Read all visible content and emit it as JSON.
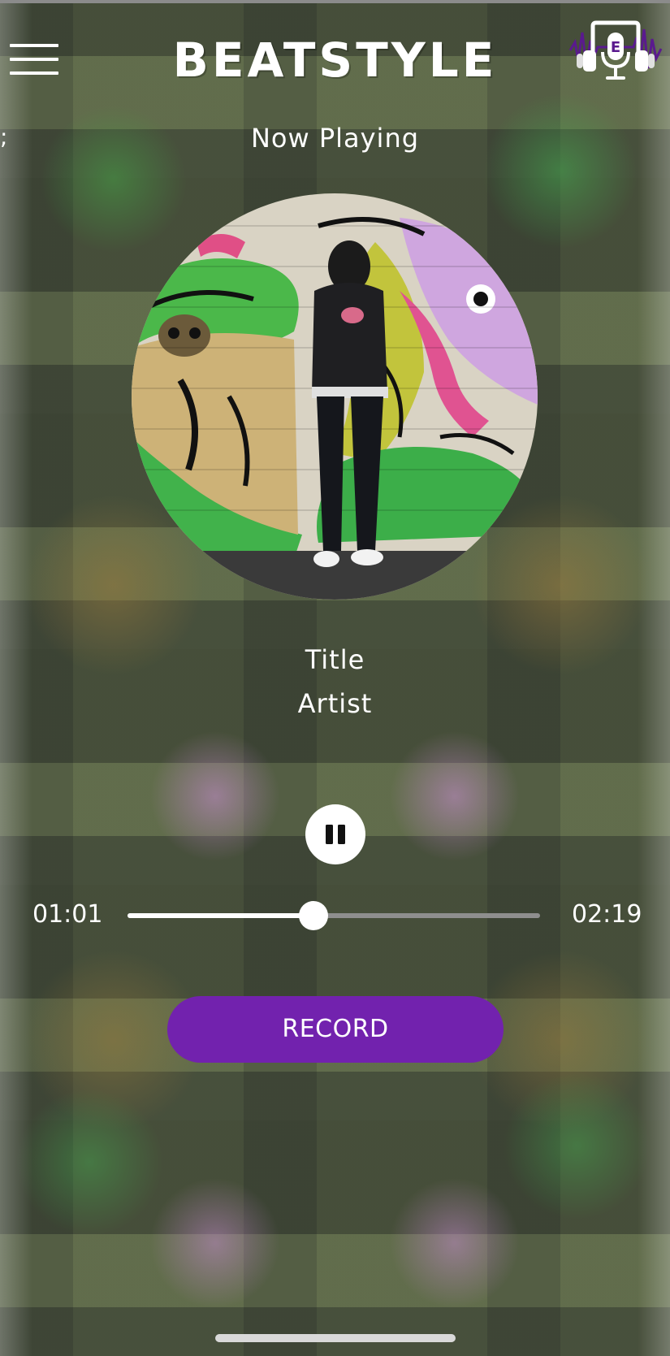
{
  "header": {
    "brand": "BEATSTYLE",
    "menu_icon": "hamburger-menu-icon",
    "logo_icon": "microphone-headphones-logo"
  },
  "stray_text": ";",
  "player": {
    "heading": "Now Playing",
    "cover_icon": "album-cover-image",
    "title": "Title",
    "artist": "Artist",
    "pause_icon": "pause-icon",
    "elapsed": "01:01",
    "total": "02:19",
    "progress": 0.45,
    "record_label": "RECORD"
  },
  "colors": {
    "accent": "#7222ae",
    "text": "#ffffff",
    "track_inactive": "#8e8e8e"
  }
}
